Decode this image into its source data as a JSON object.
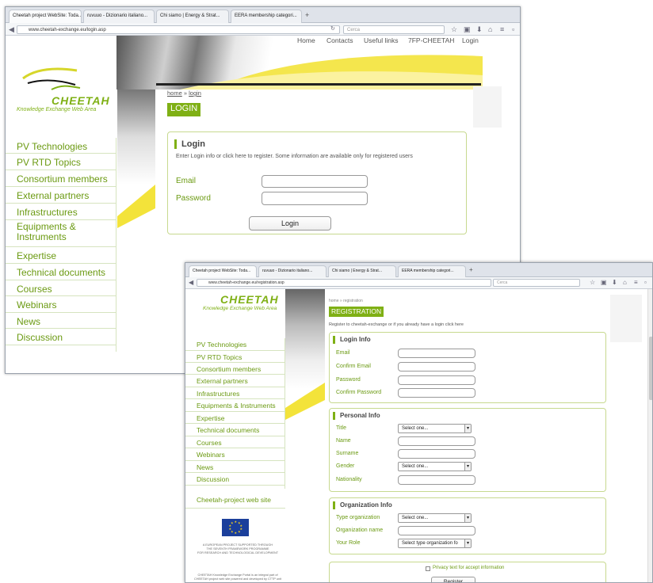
{
  "win1": {
    "tabs": [
      "Cheetah project WebSite: Toda...",
      "ruvuuo - Dizionario italiano...",
      "Chi siamo | Energy & Strat...",
      "EERA membership categori..."
    ],
    "url": "www.cheetah-exchange.eu/login.asp",
    "search_placeholder": "Cerca",
    "logo_text": "CHEETAH",
    "logo_sub": "Knowledge Exchange Web Area",
    "topnav": [
      "Home",
      "Contacts",
      "Useful links",
      "7FP-CHEETAH",
      "Login"
    ],
    "sidebar": [
      "PV Technologies",
      "PV RTD Topics",
      "Consortium members",
      "External partners",
      "Infrastructures",
      "Equipments &\nInstruments",
      "Expertise",
      "Technical documents",
      "Courses",
      "Webinars",
      "News",
      "Discussion"
    ],
    "breadcrumb_home": "home",
    "breadcrumb_sep": "»",
    "breadcrumb_current": "login",
    "page_title": "LOGIN",
    "box_title": "Login",
    "box_intro": "Enter Login info or click here to register. Some information are available only for registered users",
    "email_label": "Email",
    "password_label": "Password",
    "login_button": "Login"
  },
  "win2": {
    "tabs": [
      "Cheetah project WebSite: Toda...",
      "ruvuuo - Dizionario italiano...",
      "Chi siamo | Energy & Strat...",
      "EERA membership categori..."
    ],
    "url": "www.cheetah-exchange.eu/registration.asp",
    "search_placeholder": "Cerca",
    "logo_text": "CHEETAH",
    "logo_sub": "Knowledge Exchange Web Area",
    "sidebar": [
      "PV Technologies",
      "PV RTD Topics",
      "Consortium members",
      "External partners",
      "Infrastructures",
      "Equipments & Instruments",
      "Expertise",
      "Technical documents",
      "Courses",
      "Webinars",
      "News",
      "Discussion"
    ],
    "site_link": "Cheetah-project web site",
    "eu_text": "A EUROPEAN PROJECT SUPPORTED THROUGH\nTHE SEVENTH FRAMEWORK PROGRAMME\nFOR RESEARCH AND TECHNOLOGICAL DEVELOPMENT",
    "footer_text": "CHEETAH Knowledge Exchange Portal is an integral part of\nCHEETAH project web site powered and developed by CTTP unit",
    "breadcrumb": "home » registration",
    "page_title": "REGISTRATION",
    "intro": "Register to cheetah-exchange or if you already have a login click here",
    "login_info": {
      "title": "Login Info",
      "labels": [
        "Email",
        "Confirm Email",
        "Password",
        "Confirm Password"
      ]
    },
    "personal_info": {
      "title": "Personal Info",
      "labels": [
        "Title",
        "Name",
        "Surname",
        "Gender",
        "Nationality"
      ],
      "title_select": "Select one...",
      "gender_select": "Select one..."
    },
    "org_info": {
      "title": "Organization Info",
      "labels": [
        "Type organization",
        "Organization name",
        "Your Role"
      ],
      "type_select": "Select one...",
      "role_select": "Select type organization fo"
    },
    "privacy_label": "Privacy text for accept information",
    "register_button": "Register"
  }
}
